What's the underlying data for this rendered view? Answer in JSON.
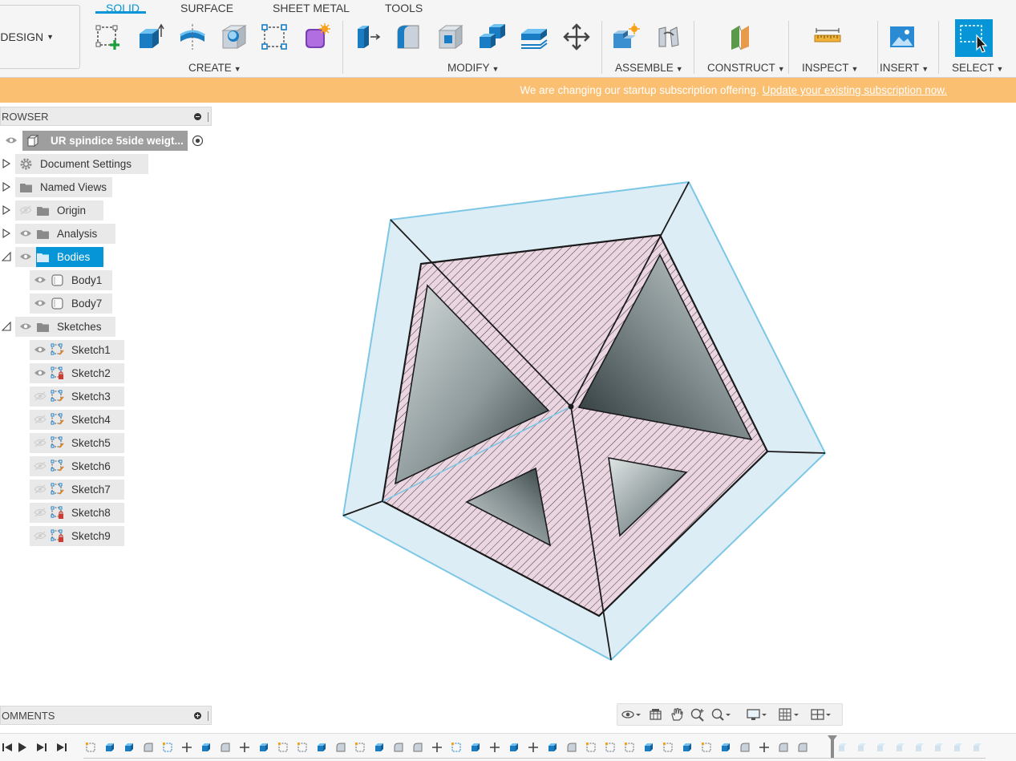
{
  "toolbar": {
    "workspace_button": "DESIGN",
    "tabs": [
      {
        "label": "SOLID",
        "active": true
      },
      {
        "label": "SURFACE",
        "active": false
      },
      {
        "label": "SHEET METAL",
        "active": false
      },
      {
        "label": "TOOLS",
        "active": false
      }
    ],
    "groups": {
      "create": "CREATE",
      "modify": "MODIFY",
      "assemble": "ASSEMBLE",
      "construct": "CONSTRUCT",
      "inspect": "INSPECT",
      "insert": "INSERT",
      "select": "SELECT"
    },
    "icons": {
      "create": [
        "create-sketch-icon",
        "extrude-icon",
        "revolve-icon",
        "hole-icon",
        "sketch-rectangle-icon",
        "create-form-icon"
      ],
      "modify": [
        "press-pull-icon",
        "fillet-icon",
        "shell-icon",
        "combine-icon",
        "offset-face-icon",
        "move-icon"
      ],
      "assemble": [
        "new-component-icon",
        "joint-icon"
      ],
      "construct": [
        "offset-plane-icon"
      ],
      "inspect": [
        "measure-icon"
      ],
      "insert": [
        "insert-image-icon"
      ],
      "select": [
        "window-select-icon"
      ]
    },
    "accent_color": "#0696d7"
  },
  "banner": {
    "message": "We are changing our startup subscription offering.",
    "link_text": "Update your existing subscription now.",
    "color": "#fbbf72"
  },
  "browser": {
    "header": "ROWSER",
    "root": "UR spindice 5side weigt...",
    "items": [
      {
        "label": "Document Settings",
        "icon": "gear-icon",
        "expand": "collapsed",
        "eye": "none"
      },
      {
        "label": "Named Views",
        "icon": "folder-icon",
        "expand": "collapsed",
        "eye": "none"
      },
      {
        "label": "Origin",
        "icon": "folder-icon",
        "expand": "collapsed",
        "eye": "hidden"
      },
      {
        "label": "Analysis",
        "icon": "folder-icon",
        "expand": "collapsed",
        "eye": "visible"
      },
      {
        "label": "Bodies",
        "icon": "folder-icon",
        "expand": "expanded",
        "eye": "visible",
        "selected": true
      },
      {
        "label": "Body1",
        "icon": "body-icon",
        "eye": "visible"
      },
      {
        "label": "Body7",
        "icon": "body-icon",
        "eye": "visible"
      },
      {
        "label": "Sketches",
        "icon": "folder-icon",
        "expand": "expanded",
        "eye": "visible"
      },
      {
        "label": "Sketch1",
        "icon": "sketch-icon",
        "eye": "visible"
      },
      {
        "label": "Sketch2",
        "icon": "sketch-locked-icon",
        "eye": "visible"
      },
      {
        "label": "Sketch3",
        "icon": "sketch-icon",
        "eye": "hidden"
      },
      {
        "label": "Sketch4",
        "icon": "sketch-icon",
        "eye": "hidden"
      },
      {
        "label": "Sketch5",
        "icon": "sketch-icon",
        "eye": "hidden"
      },
      {
        "label": "Sketch6",
        "icon": "sketch-icon",
        "eye": "hidden"
      },
      {
        "label": "Sketch7",
        "icon": "sketch-icon",
        "eye": "hidden"
      },
      {
        "label": "Sketch8",
        "icon": "sketch-locked-icon",
        "eye": "hidden"
      },
      {
        "label": "Sketch9",
        "icon": "sketch-locked-icon",
        "eye": "hidden"
      }
    ],
    "selected_color": "#0696d7"
  },
  "comments": {
    "header": "OMMENTS"
  },
  "nav_bar": {
    "icons": [
      "orbit-icon",
      "look-at-icon",
      "pan-icon",
      "zoom-icon",
      "fit-icon",
      "display-settings-icon",
      "grid-settings-icon",
      "viewports-icon"
    ]
  },
  "timeline": {
    "controls": [
      "go-to-start-icon",
      "play-icon",
      "step-forward-icon",
      "go-to-end-icon"
    ]
  }
}
